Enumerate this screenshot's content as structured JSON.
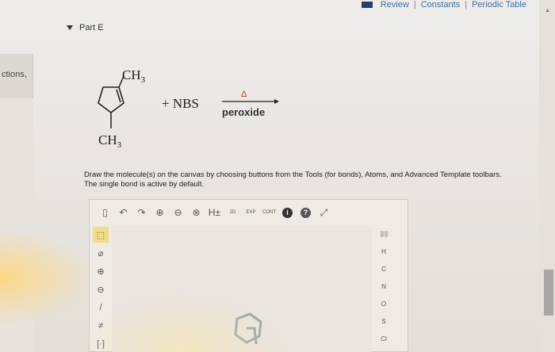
{
  "header": {
    "links": [
      "Review",
      "Constants",
      "Periodic Table"
    ],
    "separator": "|"
  },
  "sidebar": {
    "label": "ctions,"
  },
  "part": {
    "title": "Part E"
  },
  "reaction": {
    "substituent_top": "CH",
    "substituent_top_sub": "3",
    "substituent_bottom": "CH",
    "substituent_bottom_sub": "3",
    "plus_reagent": "+ NBS",
    "arrow_above": "Δ",
    "arrow_below": "peroxide"
  },
  "instructions": {
    "text": "Draw the molecule(s) on the canvas by choosing buttons from the Tools (for bonds), Atoms, and Advanced Template toolbars. The single bond is active by default."
  },
  "editor": {
    "top_tools": [
      {
        "name": "new-document-icon",
        "glyph": "▯"
      },
      {
        "name": "undo-icon",
        "glyph": "↶"
      },
      {
        "name": "redo-icon",
        "glyph": "↷"
      },
      {
        "name": "zoom-in-icon",
        "glyph": "⊕"
      },
      {
        "name": "zoom-out-icon",
        "glyph": "⊖"
      },
      {
        "name": "clear-icon",
        "glyph": "⊗"
      },
      {
        "name": "hydrogen-icon",
        "glyph": "H±"
      },
      {
        "name": "template-2d-icon",
        "glyph": "2D"
      },
      {
        "name": "explicit-icon",
        "glyph": "EXP"
      },
      {
        "name": "contract-icon",
        "glyph": "CONT"
      },
      {
        "name": "info-icon",
        "glyph": "i"
      },
      {
        "name": "help-icon",
        "glyph": "?"
      },
      {
        "name": "expand-icon",
        "glyph": "⤢"
      }
    ],
    "left_tools": [
      {
        "name": "select-icon",
        "glyph": "⬚"
      },
      {
        "name": "eraser-icon",
        "glyph": "⌀"
      },
      {
        "name": "positive-charge-icon",
        "glyph": "⊕"
      },
      {
        "name": "negative-charge-icon",
        "glyph": "⊖"
      },
      {
        "name": "single-bond-icon",
        "glyph": "/"
      },
      {
        "name": "multi-bond-icon",
        "glyph": "≠"
      },
      {
        "name": "bracket-icon",
        "glyph": "[·]"
      }
    ],
    "atoms": [
      "H",
      "C",
      "N",
      "O",
      "S",
      "Cl"
    ],
    "periodic_label": "⁝|⁝⁝|⁝"
  },
  "colors": {
    "link": "#3c6fa8",
    "delta": "#c0392b",
    "select_highlight": "#f2dd86"
  }
}
